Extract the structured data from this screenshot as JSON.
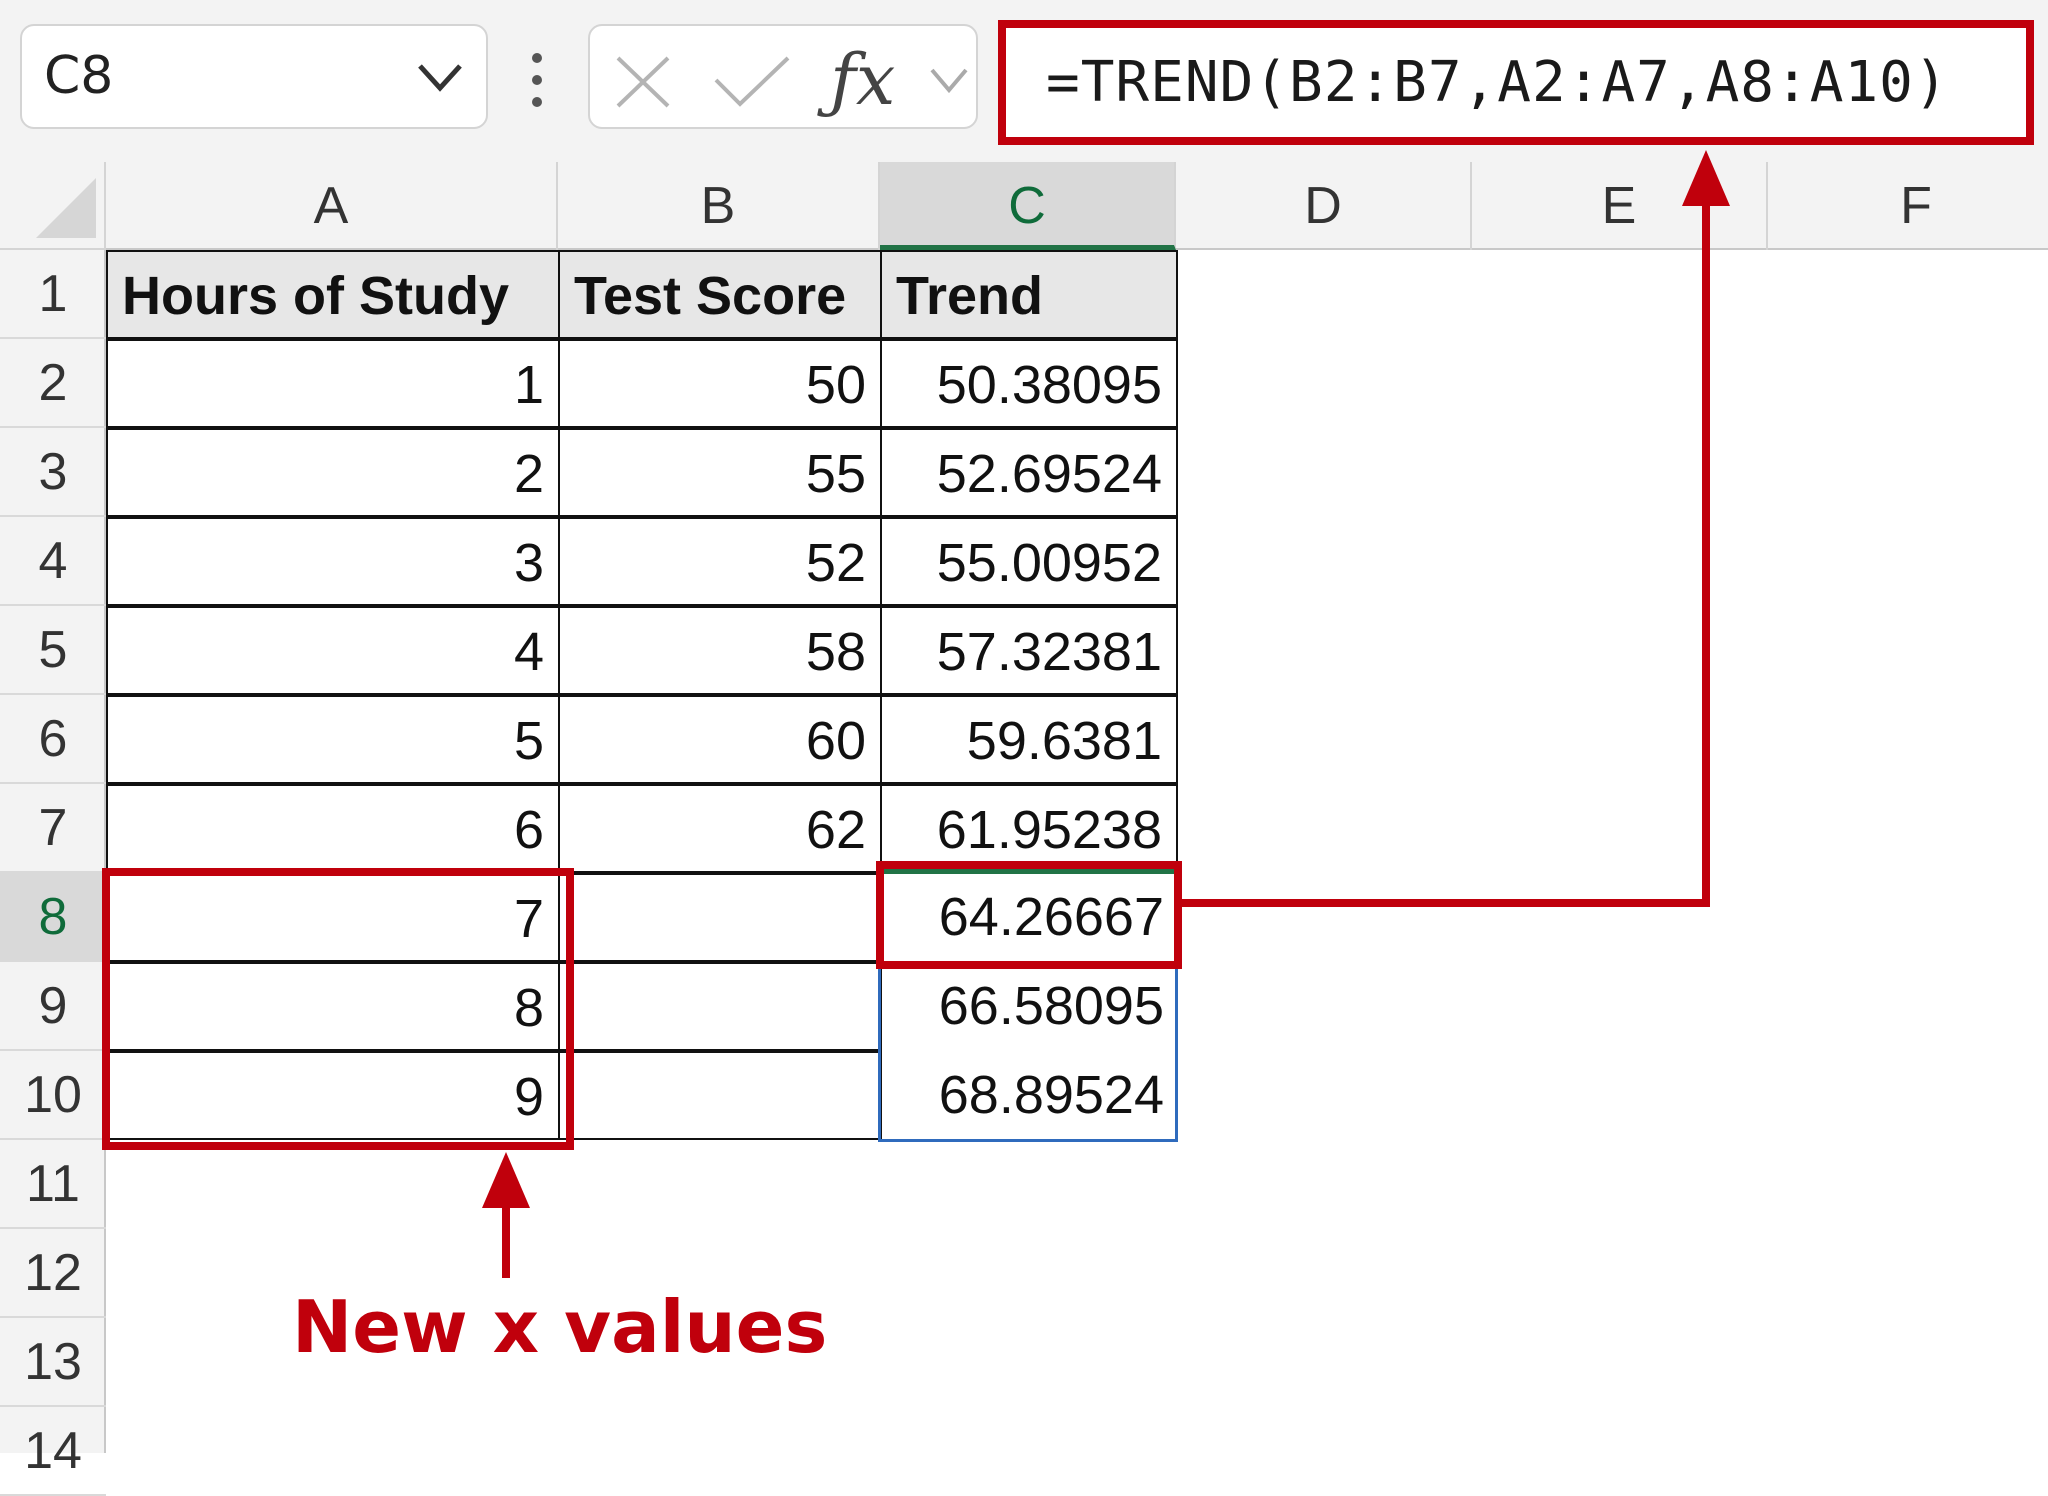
{
  "formula_bar": {
    "name_box": "C8",
    "formula": "=TREND(B2:B7,A2:A7,A8:A10)"
  },
  "icons": {
    "cancel": "close-icon",
    "enter": "checkmark-icon",
    "function": "fx-icon",
    "name_box_dropdown": "chevron-down-icon",
    "more": "vertical-dots-icon"
  },
  "columns": [
    "A",
    "B",
    "C",
    "D",
    "E",
    "F"
  ],
  "active_column": "C",
  "rows": [
    "1",
    "2",
    "3",
    "4",
    "5",
    "6",
    "7",
    "8",
    "9",
    "10",
    "11",
    "12",
    "13",
    "14"
  ],
  "active_row": "8",
  "headers": {
    "a": "Hours of Study",
    "b": "Test Score",
    "c": "Trend"
  },
  "data_rows": [
    {
      "a": "1",
      "b": "50",
      "c": "50.38095"
    },
    {
      "a": "2",
      "b": "55",
      "c": "52.69524"
    },
    {
      "a": "3",
      "b": "52",
      "c": "55.00952"
    },
    {
      "a": "4",
      "b": "58",
      "c": "57.32381"
    },
    {
      "a": "5",
      "b": "60",
      "c": "59.6381"
    },
    {
      "a": "6",
      "b": "62",
      "c": "61.95238"
    },
    {
      "a": "7",
      "b": "",
      "c": "64.26667"
    },
    {
      "a": "8",
      "b": "",
      "c": "66.58095"
    },
    {
      "a": "9",
      "b": "",
      "c": "68.89524"
    }
  ],
  "annotation": {
    "label": "New x values",
    "color": "#c0000c"
  },
  "colors": {
    "excel_green": "#217346",
    "selection_blue": "#2f6bbd",
    "header_fill": "#e7e7e7"
  }
}
